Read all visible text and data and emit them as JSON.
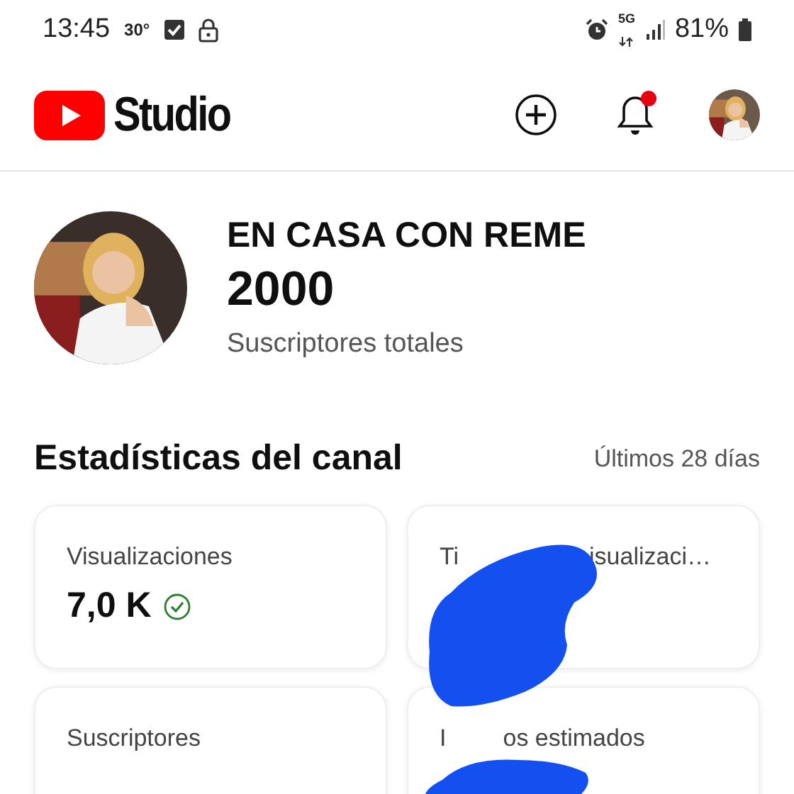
{
  "status_bar": {
    "time": "13:45",
    "temperature": "30°",
    "network": "5G",
    "battery": "81%"
  },
  "header": {
    "logo_text": "Studio",
    "notification_dot": true
  },
  "channel": {
    "name": "EN CASA CON REME",
    "subscribers": "2000",
    "subscribers_label": "Suscriptores totales"
  },
  "stats": {
    "title": "Estadísticas del canal",
    "period": "Últimos 28 días",
    "cards": [
      {
        "title_parts": [
          "Visualizaciones"
        ],
        "value": "7,0 K",
        "verified": true
      },
      {
        "title_parts": [
          "Ti",
          "isualizaci…"
        ]
      },
      {
        "title_parts": [
          "Suscriptores"
        ]
      },
      {
        "title_parts": [
          "I",
          "os estimados"
        ]
      }
    ]
  }
}
